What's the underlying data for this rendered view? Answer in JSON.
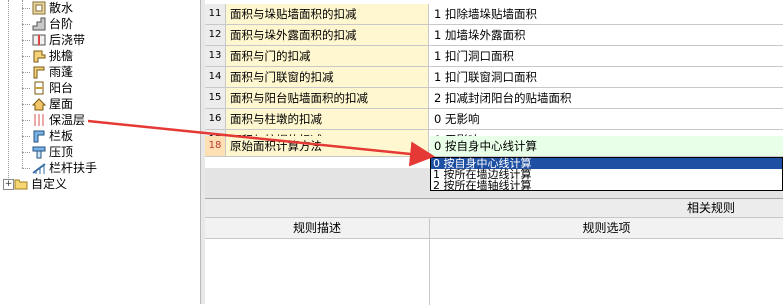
{
  "tree": {
    "items": [
      {
        "label": "散水",
        "icon": "apron-icon"
      },
      {
        "label": "台阶",
        "icon": "steps-icon"
      },
      {
        "label": "后浇带",
        "icon": "post-cast-strip-icon"
      },
      {
        "label": "挑檐",
        "icon": "cornice-icon"
      },
      {
        "label": "雨蓬",
        "icon": "canopy-icon"
      },
      {
        "label": "阳台",
        "icon": "balcony-icon"
      },
      {
        "label": "屋面",
        "icon": "roof-icon"
      },
      {
        "label": "保温层",
        "icon": "insulation-icon"
      },
      {
        "label": "栏板",
        "icon": "parapet-icon"
      },
      {
        "label": "压顶",
        "icon": "coping-icon"
      },
      {
        "label": "栏杆扶手",
        "icon": "railing-icon"
      }
    ],
    "custom": {
      "label": "自定义",
      "icon": "folder-icon",
      "expander": "+"
    }
  },
  "grid": {
    "rows": [
      {
        "num": "11",
        "name": "面积与垛贴墙面积的扣减",
        "value": "1  扣除墙垛贴墙面积"
      },
      {
        "num": "12",
        "name": "面积与垛外露面积的扣减",
        "value": "1  加墙垛外露面积"
      },
      {
        "num": "13",
        "name": "面积与门的扣减",
        "value": "1  扣门洞口面积"
      },
      {
        "num": "14",
        "name": "面积与门联窗的扣减",
        "value": "1  扣门联窗洞口面积"
      },
      {
        "num": "15",
        "name": "面积与阳台贴墙面积的扣减",
        "value": "2  扣减封闭阳台的贴墙面积"
      },
      {
        "num": "16",
        "name": "面积与柱墩的扣减",
        "value": "0   无影响"
      },
      {
        "num": "17",
        "name": "面积与柱帽的扣减",
        "value": "0   无影响"
      },
      {
        "num": "18",
        "name": "原始面积计算方法",
        "value": "0  按自身中心线计算"
      }
    ]
  },
  "dropdown": {
    "options": [
      {
        "label": "0 按自身中心线计算",
        "selected": true
      },
      {
        "label": "1 按所在墙边线计算",
        "selected": false
      },
      {
        "label": "2 按所在墙轴线计算",
        "selected": false
      }
    ]
  },
  "rules": {
    "title": "相关规则",
    "col1": "规则描述",
    "col2": "规则选项"
  },
  "colors": {
    "arrow": "#e53935",
    "accent": "#1d4fa3",
    "name_bg": "#fff7cf"
  }
}
